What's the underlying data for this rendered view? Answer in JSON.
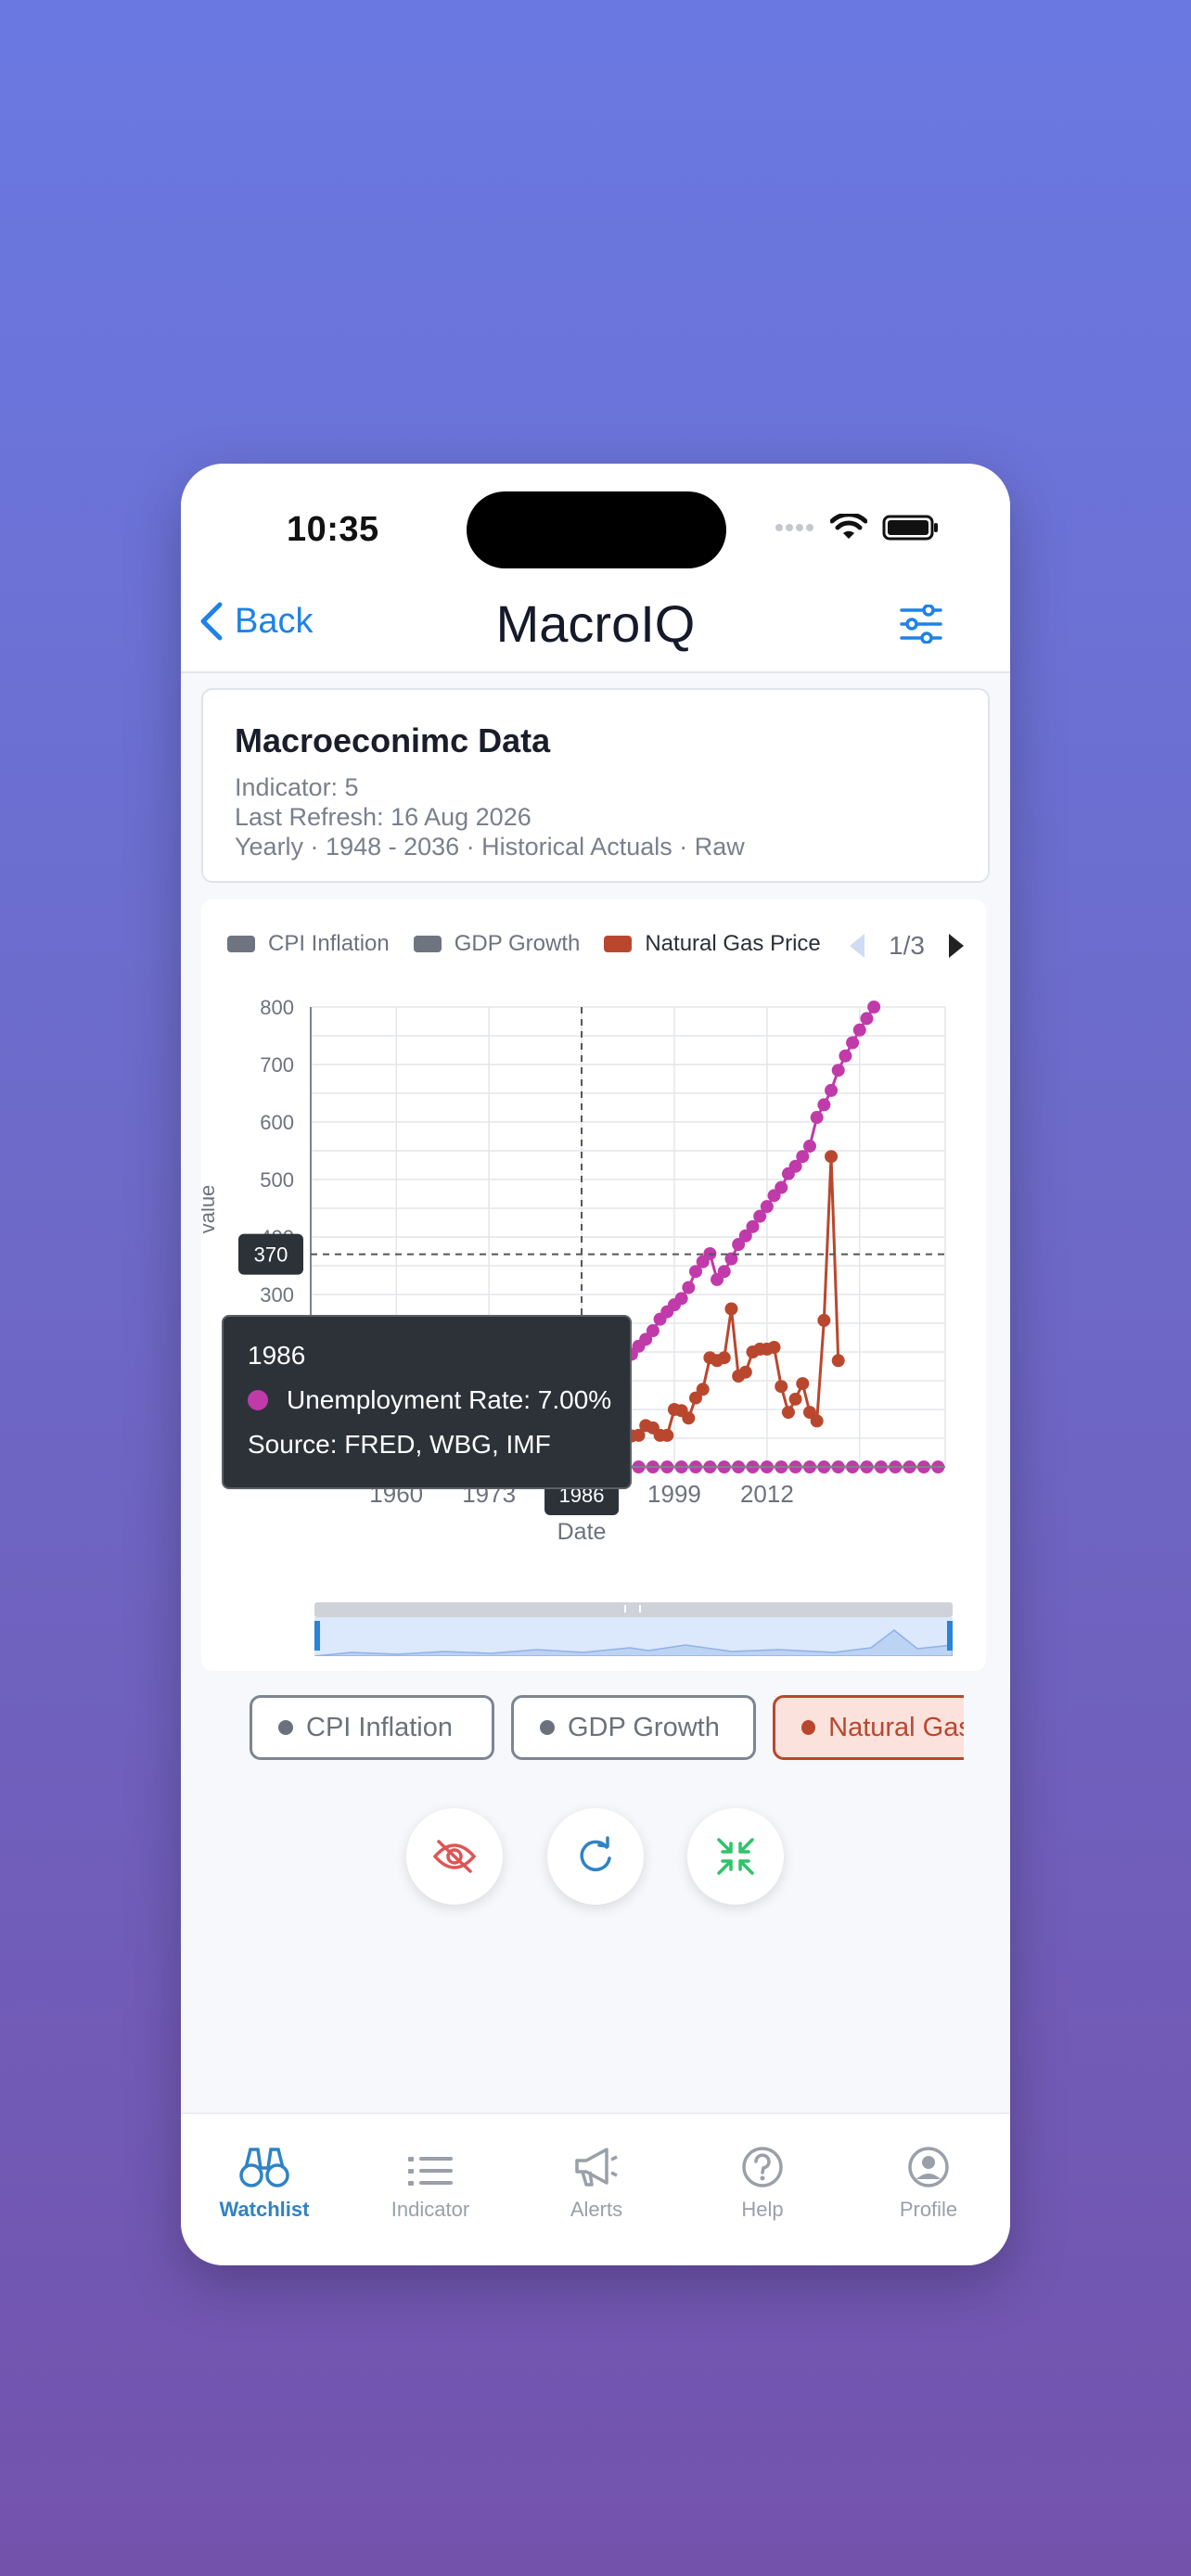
{
  "status": {
    "time": "10:35"
  },
  "nav": {
    "back_label": "Back",
    "title": "MacroIQ"
  },
  "info": {
    "title": "Macroeconimc Data",
    "indicator": "Indicator: 5",
    "last_refresh": "Last Refresh: 16 Aug 2026",
    "summary": "Yearly · 1948 - 2036 · Historical Actuals · Raw"
  },
  "legend": {
    "items": [
      {
        "label": "CPI Inflation",
        "color": "#6e7480"
      },
      {
        "label": "GDP Growth",
        "color": "#6e7480"
      },
      {
        "label": "Natural Gas Price",
        "color": "#b9472e"
      }
    ],
    "page": "1/3"
  },
  "tooltip": {
    "year": "1986",
    "series": "Unemployment Rate: 7.00%",
    "source": "Source: FRED, WBG, IMF",
    "color": "#c13aaa"
  },
  "chips": [
    {
      "label": "CPI Inflation",
      "active": false
    },
    {
      "label": "GDP Growth",
      "active": false
    },
    {
      "label": "Natural Gas Price",
      "active": true
    }
  ],
  "tabs": [
    {
      "label": "Watchlist",
      "icon": "binoculars-icon",
      "active": true
    },
    {
      "label": "Indicator",
      "icon": "list-icon",
      "active": false
    },
    {
      "label": "Alerts",
      "icon": "megaphone-icon",
      "active": false
    },
    {
      "label": "Help",
      "icon": "help-icon",
      "active": false
    },
    {
      "label": "Profile",
      "icon": "profile-icon",
      "active": false
    }
  ],
  "chart_data": {
    "type": "line",
    "xlabel": "Date",
    "ylabel": "value",
    "xlim": [
      1948,
      2037
    ],
    "ylim": [
      0,
      800
    ],
    "x_ticks": [
      "1960",
      "1973",
      "1986",
      "1999",
      "2012"
    ],
    "y_ticks": [
      "800",
      "700",
      "600",
      "500",
      "400",
      "300"
    ],
    "crosshair": {
      "x_label": "1986",
      "y_label": "370"
    },
    "series": [
      {
        "name": "Unemployment Rate",
        "color": "#c13aaa",
        "x": [
          1991,
          1992,
          1993,
          1994,
          1995,
          1996,
          1997,
          1998,
          1999,
          2000,
          2001,
          2002,
          2003,
          2004,
          2005,
          2006,
          2007,
          2008,
          2009,
          2010,
          2011,
          2012,
          2013,
          2014,
          2015,
          2016,
          2017,
          2018,
          2019,
          2020,
          2021,
          2022,
          2023,
          2024,
          2025,
          2026,
          2027
        ],
        "values": [
          163,
          180,
          196,
          210,
          222,
          237,
          257,
          270,
          282,
          293,
          312,
          340,
          357,
          371,
          326,
          340,
          362,
          387,
          402,
          418,
          436,
          453,
          472,
          486,
          510,
          523,
          540,
          558,
          608,
          630,
          655,
          690,
          715,
          738,
          760,
          780,
          800
        ]
      },
      {
        "name": "Unemployment Rate Baseline",
        "color": "#c13aaa",
        "x": [
          1986,
          1988,
          1990,
          1992,
          1994,
          1996,
          1998,
          2000,
          2002,
          2004,
          2006,
          2008,
          2010,
          2012,
          2014,
          2016,
          2018,
          2020,
          2022,
          2024,
          2026,
          2028,
          2030,
          2032,
          2034,
          2036
        ],
        "values": [
          0,
          0,
          0,
          0,
          0,
          0,
          0,
          0,
          0,
          0,
          0,
          0,
          0,
          0,
          0,
          0,
          0,
          0,
          0,
          0,
          0,
          0,
          0,
          0,
          0,
          0
        ]
      },
      {
        "name": "Natural Gas Price",
        "color": "#b9472e",
        "x": [
          1991,
          1992,
          1993,
          1994,
          1995,
          1996,
          1997,
          1998,
          1999,
          2000,
          2001,
          2002,
          2003,
          2004,
          2005,
          2006,
          2007,
          2008,
          2009,
          2010,
          2011,
          2012,
          2013,
          2014,
          2015,
          2016,
          2017,
          2018,
          2019,
          2020,
          2021,
          2022
        ],
        "values": [
          57,
          60,
          54,
          55,
          72,
          68,
          55,
          55,
          100,
          98,
          85,
          120,
          135,
          190,
          185,
          190,
          275,
          158,
          165,
          200,
          205,
          205,
          208,
          140,
          95,
          118,
          145,
          95,
          80,
          255,
          540,
          185
        ]
      }
    ]
  }
}
